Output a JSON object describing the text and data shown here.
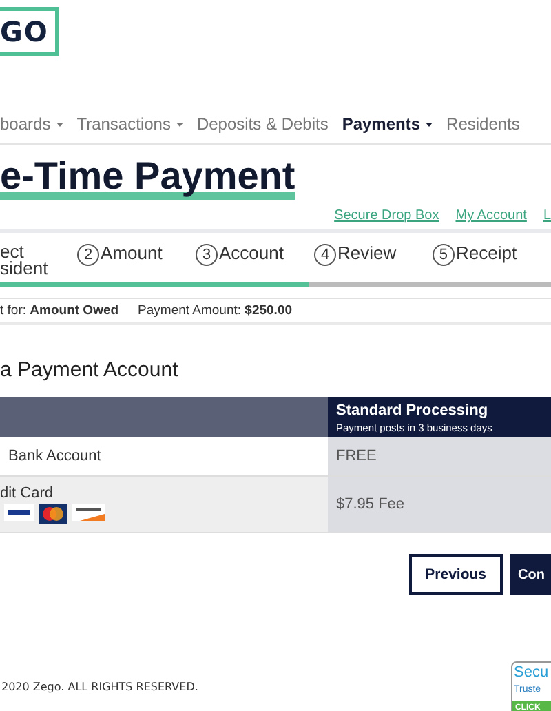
{
  "logo": {
    "text": "GO"
  },
  "nav": [
    {
      "label": "boards",
      "dropdown": true,
      "selected": false
    },
    {
      "label": "Transactions",
      "dropdown": true,
      "selected": false
    },
    {
      "label": "Deposits & Debits",
      "dropdown": false,
      "selected": false
    },
    {
      "label": "Payments",
      "dropdown": true,
      "selected": true
    },
    {
      "label": "Residents",
      "dropdown": false,
      "selected": false
    }
  ],
  "title": "e-Time Payment",
  "links": [
    "Secure Drop Box",
    "My Account",
    "L"
  ],
  "steps": [
    {
      "label": "ect\nsident"
    },
    {
      "number": "2",
      "label": "Amount"
    },
    {
      "number": "3",
      "label": "Account"
    },
    {
      "number": "4",
      "label": "Review"
    },
    {
      "number": "5",
      "label": "Receipt"
    }
  ],
  "progress": {
    "level": 0.56
  },
  "summary": [
    {
      "label": "t for:",
      "value": "Amount Owed"
    },
    {
      "label": "Payment Amount:",
      "value": "$250.00"
    }
  ],
  "section_title": "a Payment Account",
  "table": {
    "header": {
      "title": "Standard Processing",
      "subtitle": "Payment posts in 3 business days"
    },
    "rows": [
      {
        "kind": "bank",
        "method": "Bank Account",
        "fee": "FREE"
      },
      {
        "kind": "card",
        "method": "dit Card",
        "fee": "$7.95 Fee"
      }
    ]
  },
  "buttons": [
    {
      "kind": "secondary",
      "label": "Previous"
    },
    {
      "kind": "primary",
      "label": "Con"
    }
  ],
  "footer": {
    "text": "2020 Zego. ALL RIGHTS RESERVED.",
    "badge": [
      "Secu",
      "Truste",
      "CLICK"
    ]
  }
}
